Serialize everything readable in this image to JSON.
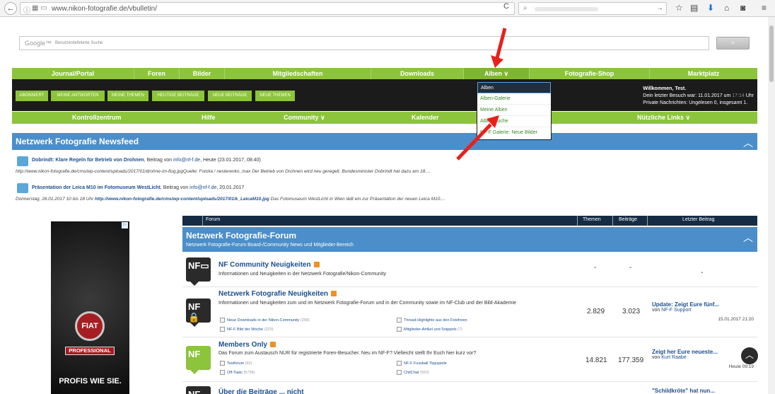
{
  "browser": {
    "url": "www.nikon-fotografie.de/vbulletin/",
    "back_label": "←",
    "reload_label": "C",
    "search_icon": "⌕",
    "go_label": "→",
    "toolbar_icons": [
      "star-icon",
      "reading-list-icon",
      "download-icon",
      "home-icon",
      "pocket-icon",
      "menu-icon"
    ]
  },
  "google_search": {
    "logo": "Google™",
    "placeholder": "Benutzerdefinierte Suche",
    "button_label": "⌕"
  },
  "nav_main": [
    {
      "label": "Journal/Portal"
    },
    {
      "label": "Foren"
    },
    {
      "label": "Bilder"
    },
    {
      "label": "Mitgliedschaften"
    },
    {
      "label": "Downloads"
    },
    {
      "label": "Alben ∨"
    },
    {
      "label": "Fotografie-Shop"
    },
    {
      "label": "Marktplatz"
    }
  ],
  "subnav_pills": [
    "ABONNIERT",
    "MEINE ANTWORTEN",
    "MEINE THEMEN",
    "HEUTIGE BEITRÄGE",
    "NEUE BEITRÄGE",
    "NEUE THEMEN"
  ],
  "welcome": {
    "line1": "Willkommen, Test.",
    "line2_prefix": "Dein letzter Besuch war: 11.01.2017 um ",
    "line2_time": "17:14",
    "line2_suffix": " Uhr",
    "line3": "Private Nachrichten: Ungelesen 0, insgesamt 1."
  },
  "nav_secondary": [
    "Kontrollzentrum",
    "Hilfe",
    "Community ∨",
    "Kalender",
    "Nützliche Links ∨"
  ],
  "alben_dropdown": [
    "Alben",
    "Alben-Galerie",
    "Meine Alben",
    "Alben/Suche",
    "NF-F Galerie: Neue Bilder"
  ],
  "newsfeed": {
    "title": "Netzwerk Fotografie Newsfeed",
    "items": [
      {
        "title": "Dobrindt: Klare Regeln für Betrieb von Drohnen",
        "by": ", Beitrag von ",
        "author": "info@nf-f.de",
        "date": ", Heute (23.01.2017, 08:40)",
        "body": "http://www.nikon-fotografie.de/cms/wp-content/uploads/2017/01/drohne-im-flug.jpgQuelle: Fotolia / nesterenko_max Der Betrieb von Drohnen wird neu geregelt. Bundesminister Dobrindt hat dazu am 18...."
      },
      {
        "title": "Präsentation der Leica M10 im Fotomuseum WestLicht",
        "by": ", Beitrag von ",
        "author": "info@nf-f.de",
        "date": ", 20.01.2017",
        "body_prefix": "Donnerstag, 26.01.2017 10 bis 18 Uhr ",
        "body_link": "http://www.nikon-fotografie.de/cms/wp-content/uploads/2017/01/k_LeicaM10.jpg",
        "body_suffix": " Das Fotomuseum WestLicht in Wien lädt ein zur Präsentation der neuen Leica M10...."
      }
    ]
  },
  "ad": {
    "brand": "FIAT",
    "badge": "PROFESSIONAL",
    "slogan": "PROFIS WIE SIE.",
    "close": "▷"
  },
  "forum_table": {
    "headers": {
      "forum": "Forum",
      "themen": "Themen",
      "beitraege": "Beiträge",
      "last": "Letzter Beitrag"
    },
    "category_title": "Netzwerk Fotografie-Forum",
    "category_sub": "Netzwerk Fotografie-Forum Board-/Community News und Mitglieder-Bereich",
    "rows": [
      {
        "title": "NF Community Neuigkeiten",
        "desc": "Informationen und Neuigkeiten in der Netzwerk Fotografie/Nikon-Community",
        "themen": "-",
        "beitraege": "-",
        "last": "-"
      },
      {
        "title": "Netzwerk Fotografie Neuigkeiten",
        "desc": "Informationen und Neuigkeiten zum und im Netzwerk Fotografie-Forum und in der Community sowie im NF-Club und der Bild-Akademie",
        "subs": [
          {
            "label": "Neue Downloads in der Nikon-Community",
            "count": "(258)"
          },
          {
            "label": "Thread-Highlights aus den Fotoforen",
            "count": ""
          },
          {
            "label": "NF-F Bild der Woche",
            "count": "(223)"
          },
          {
            "label": "Mitglieder-Artikel und Snippets",
            "count": "(7)"
          }
        ],
        "themen": "2.829",
        "beitraege": "3.023",
        "last_title": "Update: Zeigt Eure fünf...",
        "last_by": "von ",
        "last_author": "NF-F Support",
        "last_date": "15.01.2017 21:20"
      },
      {
        "title": "Members Only",
        "desc": "Das Forum zum Austausch NUR für registrierte Foren-Besucher. Neu im NF-F? Vielleicht stellt Ihr Euch hier kurz vor?",
        "subs": [
          {
            "label": "Testforum",
            "count": "(92)"
          },
          {
            "label": "NF-F Fussball Tippspiele",
            "count": ""
          },
          {
            "label": "Off-Topic",
            "count": "(5738)"
          },
          {
            "label": "ChitChat",
            "count": "(552)"
          }
        ],
        "themen": "14.821",
        "beitraege": "177.359",
        "last_title": "Zeigt her Eure neueste...",
        "last_by": "von ",
        "last_author": "Kurt Raabe",
        "last_date": "Heute 09:19"
      },
      {
        "title": "Über die Beiträge ... nicht",
        "last_title": "\"Schildkröte\" hat nun..."
      }
    ]
  },
  "colors": {
    "green": "#8cc43c",
    "blue": "#4b8ec9",
    "navy": "#162c45",
    "arrow": "#e8201c"
  }
}
